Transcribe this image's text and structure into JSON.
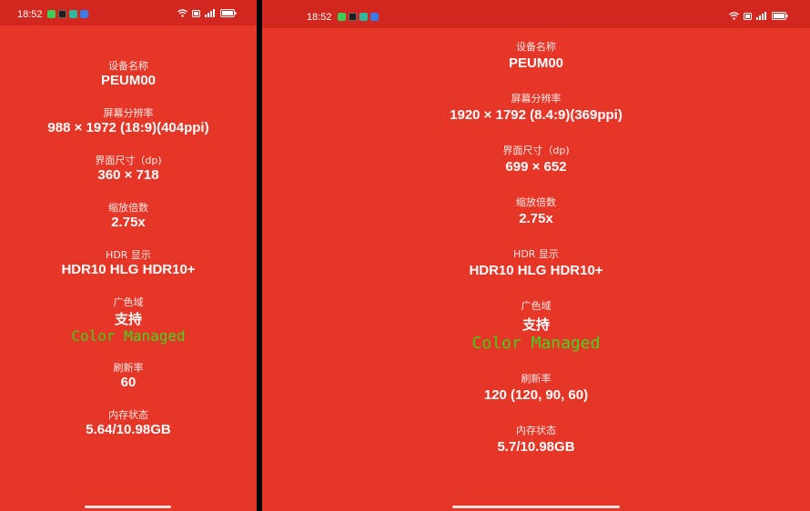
{
  "left": {
    "status_time": "18:52",
    "items": [
      {
        "label": "设备名称",
        "value": "PEUM00"
      },
      {
        "label": "屏幕分辨率",
        "value": "988 × 1972 (18:9)(404ppi)"
      },
      {
        "label": "界面尺寸（dp)",
        "value": "360 × 718"
      },
      {
        "label": "缩放倍数",
        "value": "2.75x"
      },
      {
        "label": "HDR 显示",
        "value": "HDR10 HLG HDR10+"
      },
      {
        "label": "广色域",
        "value": "支持"
      },
      {
        "label": "刷新率",
        "value": "60"
      },
      {
        "label": "内存状态",
        "value": "5.64/10.98GB"
      }
    ],
    "overlay": {
      "word1": "Color",
      "word2": "Managed"
    }
  },
  "right": {
    "status_time": "18:52",
    "items": [
      {
        "label": "设备名称",
        "value": "PEUM00"
      },
      {
        "label": "屏幕分辨率",
        "value": "1920 × 1792 (8.4:9)(369ppi)"
      },
      {
        "label": "界面尺寸（dp)",
        "value": "699 × 652"
      },
      {
        "label": "缩放倍数",
        "value": "2.75x"
      },
      {
        "label": "HDR 显示",
        "value": "HDR10 HLG HDR10+"
      },
      {
        "label": "广色域",
        "value": "支持"
      },
      {
        "label": "刷新率",
        "value": "120 (120, 90, 60)"
      },
      {
        "label": "内存状态",
        "value": "5.7/10.98GB"
      }
    ],
    "overlay": {
      "word1": "Color",
      "word2": "Managed"
    }
  },
  "status_icons": [
    "wifi-icon",
    "hd-icon",
    "signal-icon",
    "battery-icon"
  ],
  "notification_icons": [
    "app-green-icon",
    "app-dark-icon",
    "app-teal-icon",
    "app-blue-icon"
  ],
  "colors": {
    "background": "#E63628",
    "statusbar": "#D2271E",
    "overlay_text": "#3ED018",
    "text": "#FFFFFF"
  }
}
